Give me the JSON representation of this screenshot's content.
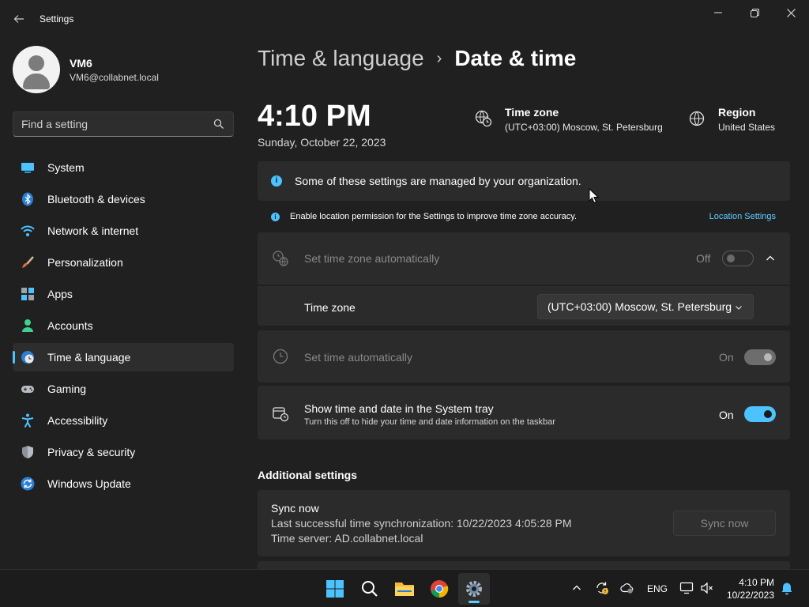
{
  "window": {
    "title": "Settings"
  },
  "user": {
    "name": "VM6",
    "email": "VM6@collabnet.local"
  },
  "search": {
    "placeholder": "Find a setting"
  },
  "sidebar": {
    "items": [
      {
        "label": "System",
        "icon": "system-icon"
      },
      {
        "label": "Bluetooth & devices",
        "icon": "bluetooth-icon"
      },
      {
        "label": "Network & internet",
        "icon": "wifi-icon"
      },
      {
        "label": "Personalization",
        "icon": "brush-icon"
      },
      {
        "label": "Apps",
        "icon": "apps-icon"
      },
      {
        "label": "Accounts",
        "icon": "person-icon"
      },
      {
        "label": "Time & language",
        "icon": "globe-clock-icon",
        "selected": true
      },
      {
        "label": "Gaming",
        "icon": "gamepad-icon"
      },
      {
        "label": "Accessibility",
        "icon": "accessibility-icon"
      },
      {
        "label": "Privacy & security",
        "icon": "shield-icon"
      },
      {
        "label": "Windows Update",
        "icon": "update-icon"
      }
    ]
  },
  "breadcrumb": {
    "parent": "Time & language",
    "current": "Date & time"
  },
  "clock": {
    "time": "4:10 PM",
    "date": "Sunday, October 22, 2023"
  },
  "timezone_summary": {
    "title": "Time zone",
    "value": "(UTC+03:00) Moscow, St. Petersburg"
  },
  "region_summary": {
    "title": "Region",
    "value": "United States"
  },
  "banner": {
    "text": "Some of these settings are managed by your organization."
  },
  "location_notice": {
    "text": "Enable location permission for the Settings to improve time zone accuracy.",
    "link": "Location Settings"
  },
  "settings": {
    "auto_timezone": {
      "label": "Set time zone automatically",
      "state": "Off"
    },
    "timezone": {
      "label": "Time zone",
      "value": "(UTC+03:00) Moscow, St. Petersburg"
    },
    "auto_time": {
      "label": "Set time automatically",
      "state": "On"
    },
    "tray": {
      "label": "Show time and date in the System tray",
      "description": "Turn this off to hide your time and date information on the taskbar",
      "state": "On"
    }
  },
  "additional": {
    "heading": "Additional settings",
    "sync": {
      "title": "Sync now",
      "last_sync": "Last successful time synchronization: 10/22/2023 4:05:28 PM",
      "server": "Time server: AD.collabnet.local",
      "button": "Sync now"
    }
  },
  "taskbar": {
    "language": "ENG",
    "time": "4:10 PM",
    "date": "10/22/2023"
  },
  "colors": {
    "accent": "#4cc2ff",
    "background": "#202020",
    "card": "#2b2b2b",
    "link": "#60cdff"
  }
}
